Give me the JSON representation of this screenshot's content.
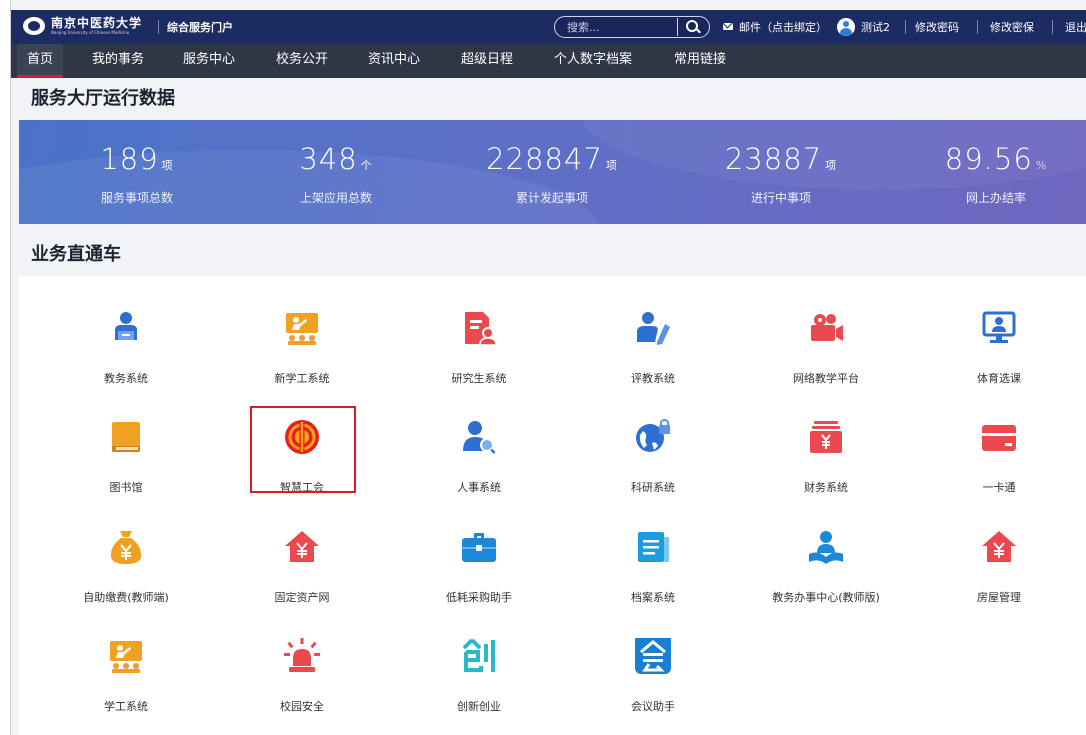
{
  "header": {
    "logo_cn": "南京中医药大学",
    "logo_en": "Nanjing University of Chinese Medicine",
    "portal_title": "综合服务门户",
    "search_placeholder": "搜索...",
    "mail_text": "邮件（点击绑定）",
    "user_name": "测试2",
    "change_password": "修改密码",
    "change_security": "修改密保",
    "logout": "退出"
  },
  "nav": {
    "items": [
      "首页",
      "我的事务",
      "服务中心",
      "校务公开",
      "资讯中心",
      "超级日程",
      "个人数字档案",
      "常用链接"
    ],
    "active": "首页"
  },
  "stats_section": {
    "title": "服务大厅运行数据",
    "items": [
      {
        "value": "189",
        "unit": "项",
        "label": "服务事项总数"
      },
      {
        "value": "348",
        "unit": "个",
        "label": "上架应用总数"
      },
      {
        "value": "228847",
        "unit": "项",
        "label": "累计发起事项"
      },
      {
        "value": "23887",
        "unit": "项",
        "label": "进行中事项"
      },
      {
        "value": "89.56",
        "unit": "%",
        "label": "网上办结率"
      }
    ]
  },
  "apps_section": {
    "title": "业务直通车",
    "highlighted": "智慧工会",
    "apps": [
      {
        "label": "教务系统",
        "icon": "teacher-icon"
      },
      {
        "label": "新学工系统",
        "icon": "classroom-icon"
      },
      {
        "label": "研究生系统",
        "icon": "student-document-icon"
      },
      {
        "label": "评教系统",
        "icon": "evaluation-icon"
      },
      {
        "label": "网络教学平台",
        "icon": "video-camera-icon"
      },
      {
        "label": "体育选课",
        "icon": "monitor-person-icon"
      },
      {
        "label": "图书馆",
        "icon": "book-icon"
      },
      {
        "label": "智慧工会",
        "icon": "trade-union-icon"
      },
      {
        "label": "人事系统",
        "icon": "personnel-search-icon"
      },
      {
        "label": "科研系统",
        "icon": "globe-lock-icon"
      },
      {
        "label": "财务系统",
        "icon": "yuan-box-icon"
      },
      {
        "label": "一卡通",
        "icon": "card-icon"
      },
      {
        "label": "自助缴费(教师端)",
        "icon": "money-bag-icon"
      },
      {
        "label": "固定资产网",
        "icon": "house-yuan-icon"
      },
      {
        "label": "低耗采购助手",
        "icon": "briefcase-icon"
      },
      {
        "label": "档案系统",
        "icon": "archive-icon"
      },
      {
        "label": "教务办事中心(教师版)",
        "icon": "reading-person-icon"
      },
      {
        "label": "房屋管理",
        "icon": "house-yuan-icon"
      },
      {
        "label": "学工系统",
        "icon": "classroom-icon"
      },
      {
        "label": "校园安全",
        "icon": "alarm-light-icon"
      },
      {
        "label": "创新创业",
        "icon": "chuang-icon"
      },
      {
        "label": "会议助手",
        "icon": "meeting-icon"
      }
    ]
  }
}
